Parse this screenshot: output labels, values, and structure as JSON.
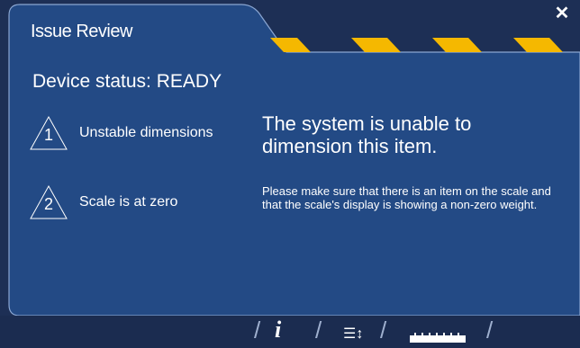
{
  "window": {
    "title": "Issue Review",
    "close_icon": "close-icon",
    "colors": {
      "background": "#1d2f55",
      "panel": "#234a85",
      "panel_border": "#7f9cc8",
      "stripe": "#f5b800"
    }
  },
  "status": {
    "device_status": "Device status: READY"
  },
  "issues": [
    {
      "number": "1",
      "label": "Unstable dimensions"
    },
    {
      "number": "2",
      "label": "Scale is at zero"
    }
  ],
  "message": {
    "title": "The system is unable to dimension this item.",
    "body": "Please make sure that there is an item on the scale and that the scale's display is showing a non-zero weight."
  },
  "footer": {
    "buttons": [
      {
        "name": "info-button",
        "icon": "info-icon",
        "glyph": "i"
      },
      {
        "name": "sort-button",
        "icon": "sort-icon",
        "glyph": "☰↕"
      },
      {
        "name": "ruler-button",
        "icon": "ruler-icon"
      }
    ]
  }
}
